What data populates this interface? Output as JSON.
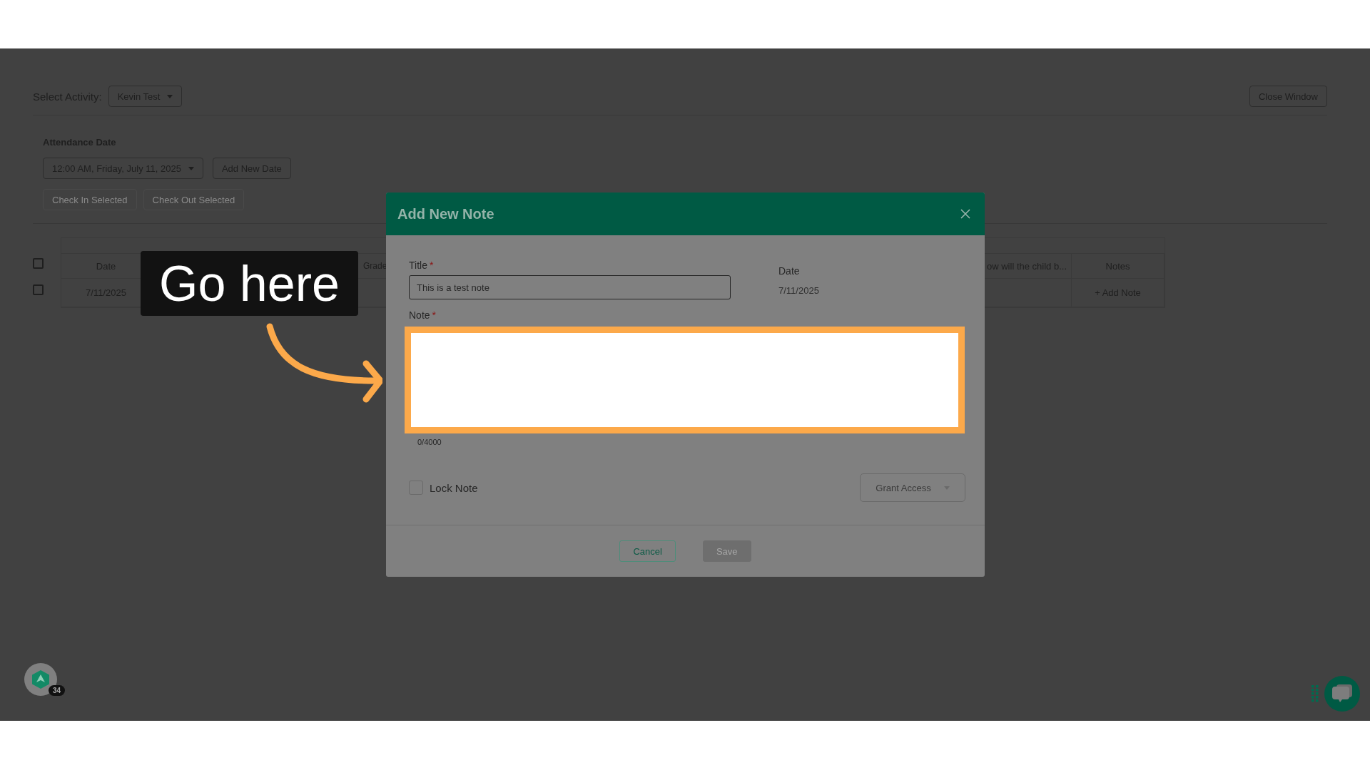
{
  "top_bar": {
    "activity_label": "Select Activity:",
    "activity_value": "Kevin Test",
    "close_button": "Close Window"
  },
  "attendance": {
    "label": "Attendance Date",
    "date_value": "12:00 AM, Friday, July 11, 2025",
    "add_date_button": "Add New Date",
    "actions": [
      {
        "label": "Check In Selected",
        "disabled": true
      },
      {
        "label": "Check Out Selected",
        "disabled": true
      }
    ]
  },
  "table": {
    "header_checked": false,
    "columns": [
      {
        "label": "Date"
      },
      {
        "label": "Grade"
      },
      {
        "label": "ow will the child b..."
      },
      {
        "label": "Notes"
      }
    ],
    "rows": [
      {
        "checked": false,
        "date": "7/11/2025",
        "notes": "+ Add Note"
      }
    ]
  },
  "modal": {
    "title": "Add New Note",
    "title_field": {
      "label": "Title",
      "required_mark": "*",
      "value": "This is a test note"
    },
    "date_field": {
      "label": "Date",
      "value": "7/11/2025"
    },
    "note_field": {
      "label": "Note",
      "required_mark": "*",
      "highlighted": true,
      "counter": "0/4000"
    },
    "lock": {
      "label": "Lock Note",
      "checked": false
    },
    "grant_access": "Grant Access",
    "buttons": [
      {
        "label": "Cancel",
        "kind": "secondary",
        "disabled": false
      },
      {
        "label": "Save",
        "kind": "primary",
        "disabled": true
      }
    ]
  },
  "callout": {
    "text": "Go here"
  },
  "help_badge": {
    "count": "34"
  }
}
